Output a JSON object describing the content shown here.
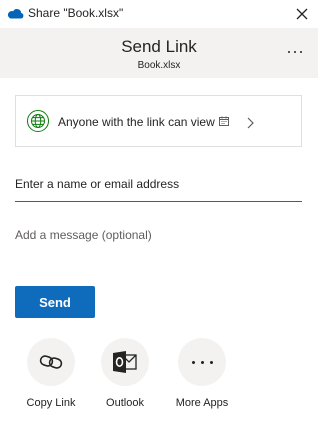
{
  "window": {
    "title": "Share \"Book.xlsx\"",
    "close_icon": "close-icon",
    "app_icon": "onedrive-cloud-icon"
  },
  "header": {
    "title": "Send Link",
    "file_name": "Book.xlsx",
    "more_icon": "more-options-icon"
  },
  "permission": {
    "label": "Anyone with the link can view",
    "icon": "globe-icon",
    "expiry_icon": "calendar-icon",
    "chevron_icon": "chevron-right-icon",
    "accent_color": "#107c10"
  },
  "recipients": {
    "placeholder": "Enter a name or email address",
    "value": ""
  },
  "message": {
    "placeholder": "Add a message (optional)",
    "value": ""
  },
  "send_button": {
    "label": "Send",
    "color": "#0f6cbd"
  },
  "share_apps": [
    {
      "label": "Copy Link",
      "icon": "link-icon"
    },
    {
      "label": "Outlook",
      "icon": "outlook-icon"
    },
    {
      "label": "More Apps",
      "icon": "more-apps-icon"
    }
  ]
}
